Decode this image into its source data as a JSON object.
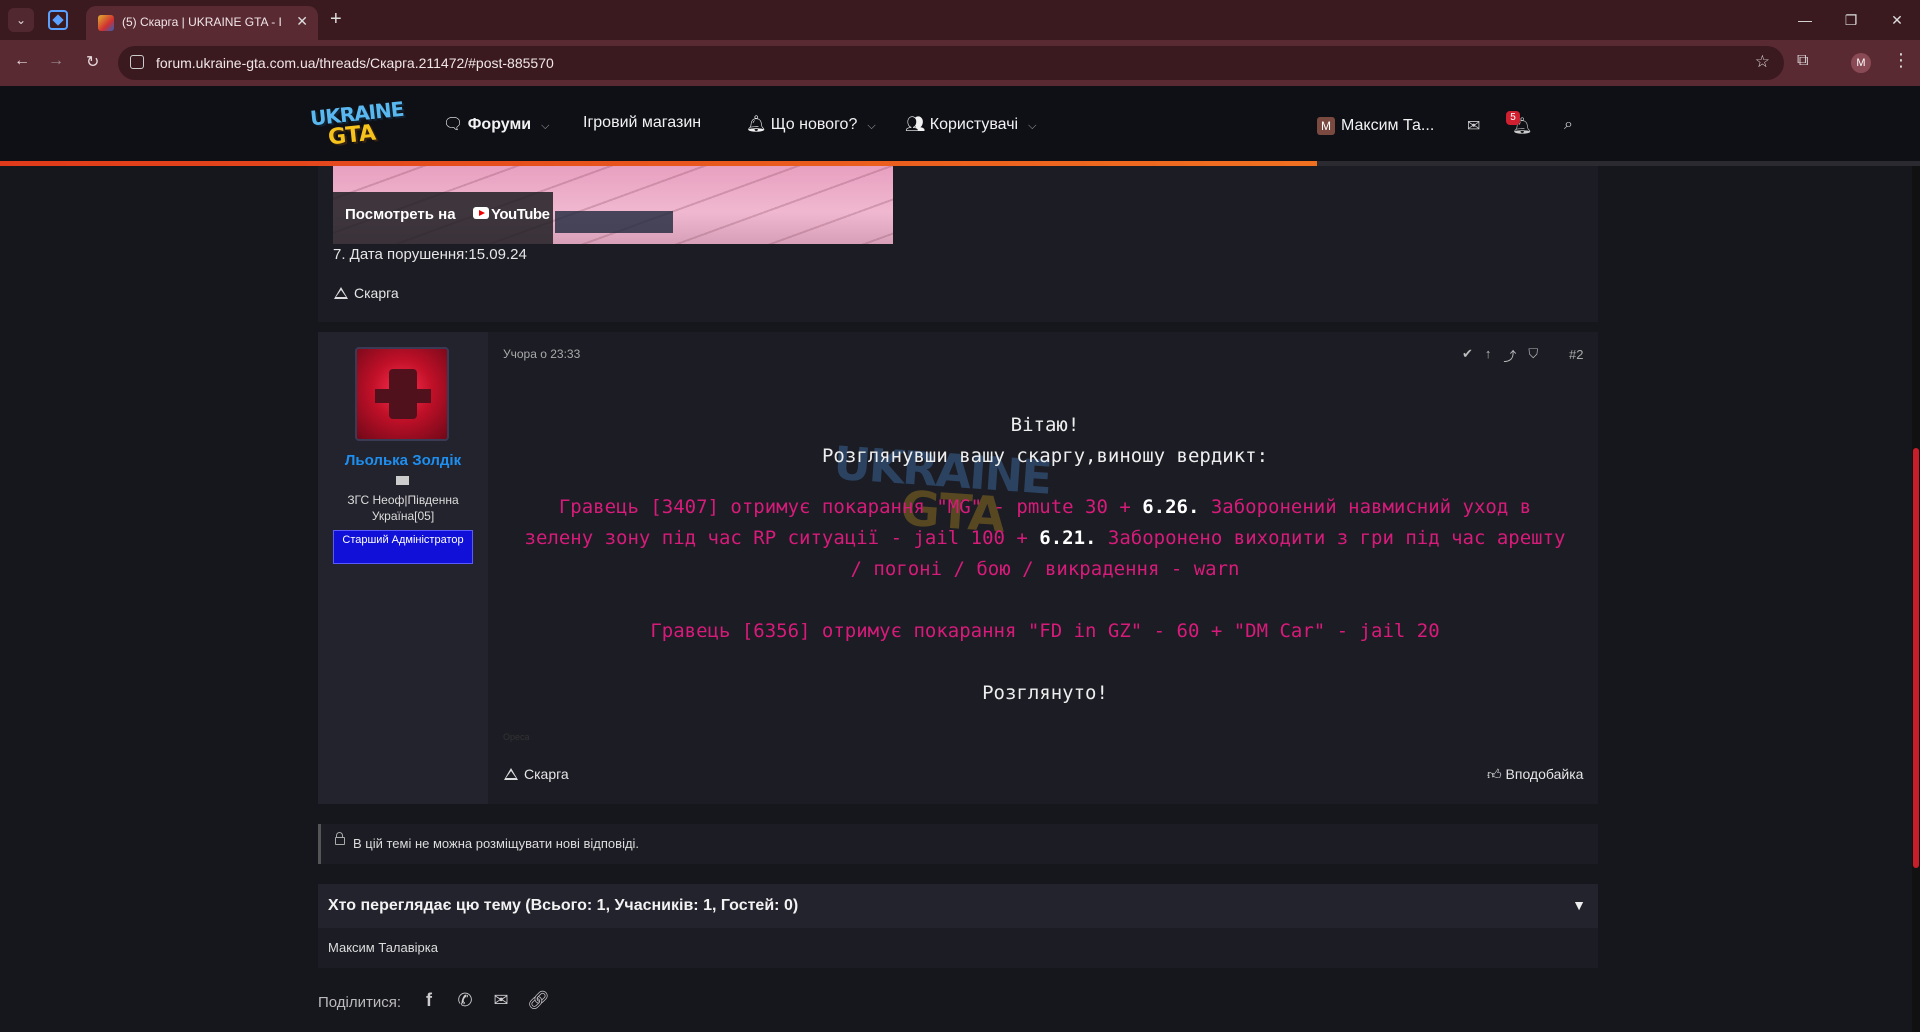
{
  "browser": {
    "tab_title": "(5) Скарга | UKRAINE GTA - Ігро",
    "tab_close": "✕",
    "new_tab": "+",
    "url": "forum.ukraine-gta.com.ua/threads/Скарга.211472/#post-885570",
    "profile_initial": "M"
  },
  "header": {
    "logo_top": "UKRAINE",
    "logo_bottom": "GTA",
    "nav": [
      {
        "label": "Форуми",
        "icon": "chat-icon"
      },
      {
        "label": "Ігровий магазин"
      },
      {
        "label": "Що нового?",
        "icon": "bell-icon"
      },
      {
        "label": "Користувачі",
        "icon": "users-icon"
      }
    ],
    "user_initial": "M",
    "user_name": "Максим Та...",
    "alerts_count": "5",
    "progress_fraction": 0.686
  },
  "post1": {
    "video_overlay": "Посмотреть на",
    "video_brand": "YouTube",
    "date_line": "7. Дата порушення:15.09.24",
    "report_label": "Скарга"
  },
  "post2": {
    "author": "Льолька Золдік",
    "user_title": "ЗГС Неоф|Південна Україна[05]",
    "user_banner": "Старший Адміністратор",
    "time": "Учора о 23:33",
    "number": "#2",
    "greeting": "Вітаю!",
    "intro": "Розглянувши вашу скаргу,виношу вердикт:",
    "verdict1_a": "Гравець [3407] отримує покарання \"MG\" - pmute 30 + ",
    "verdict1_b": "6.26.",
    "verdict1_c": " Заборонений навмисний уход в зелену зону під час RP ситуації - jail 100 + ",
    "verdict1_d": "6.21.",
    "verdict1_e": " Забороненo виходити з гри під час арешту / погоні / бою / викрадення - warn",
    "verdict2": "Гравець [6356] отримує покарання \"FD in GZ\" - 60 + \"DM Car\" - jail 20",
    "closing": "Розглянуто!",
    "signature": "Opeca",
    "report_label": "Скарга",
    "like_label": "Вподобайка",
    "watermark_top": "UKRAINE",
    "watermark_bottom": "GTA"
  },
  "locked_notice": "В цій темі не можна розміщувати нові відповіді.",
  "viewers": {
    "title": "Хто переглядає цю тему (Всього: 1, Учасників: 1, Гостей: 0)",
    "names": "Максим Талавірка"
  },
  "share": {
    "label": "Поділитися:"
  }
}
